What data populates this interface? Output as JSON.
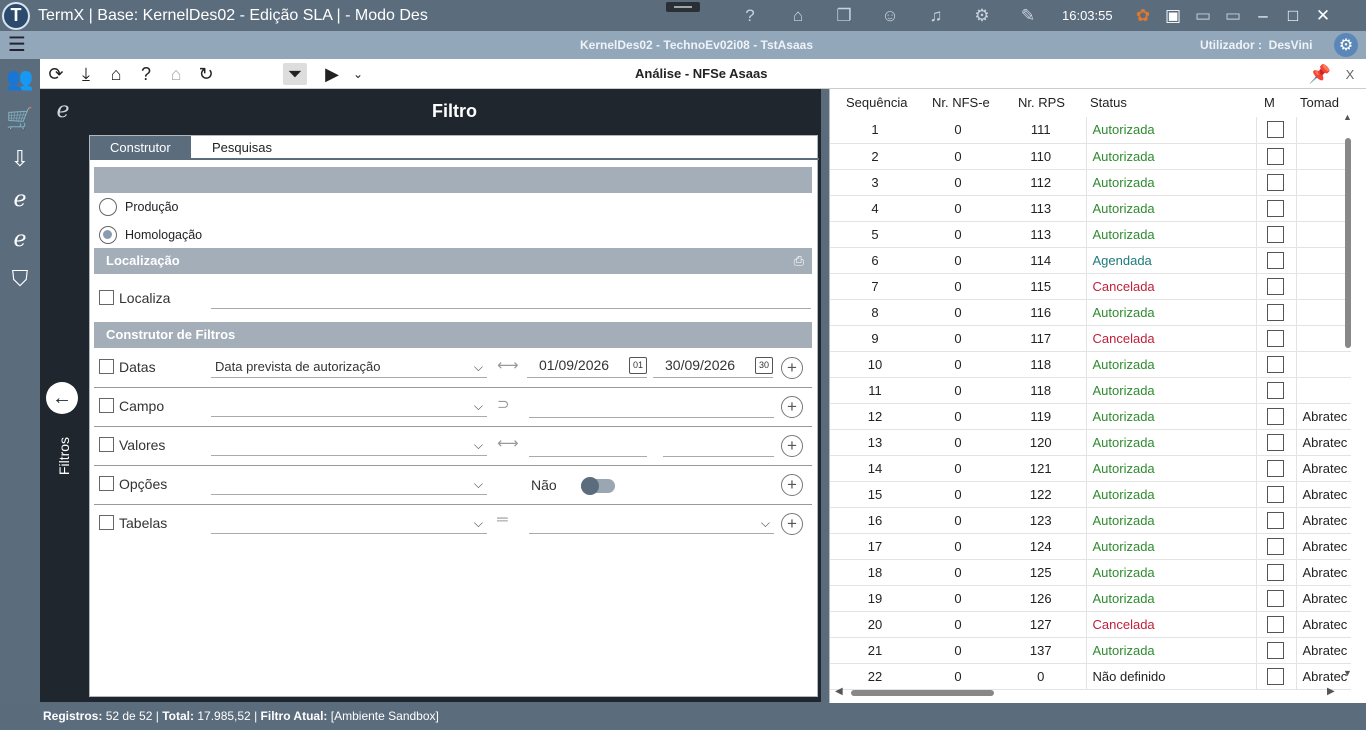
{
  "window": {
    "title": "TermX | Base: KernelDes02 - Edição SLA | - Modo Des",
    "clock": "16:03:55"
  },
  "header": {
    "context": "KernelDes02 - TechnoEv02i08 - TstAsaas",
    "user_label": "Utilizador :",
    "user_name": "DesVini"
  },
  "toolbar": {
    "doc_title": "Análise - NFSe Asaas",
    "close": "X"
  },
  "filter": {
    "title": "Filtro",
    "side_label": "Filtros",
    "tabs": [
      "Construtor",
      "Pesquisas"
    ],
    "env": {
      "option1": "Produção",
      "option2": "Homologação",
      "selected": "Homologação"
    },
    "sec_local": "Localização",
    "localiza_label": "Localiza",
    "sec_builder": "Construtor de Filtros",
    "rows": {
      "datas": {
        "label": "Datas",
        "field": "Data prevista de autorização",
        "from": "01/09/2026",
        "to": "30/09/2026",
        "cal_from": "01",
        "cal_to": "30"
      },
      "campo": {
        "label": "Campo"
      },
      "valores": {
        "label": "Valores"
      },
      "opcoes": {
        "label": "Opções",
        "toggle_text": "Não"
      },
      "tabelas": {
        "label": "Tabelas"
      }
    }
  },
  "grid": {
    "columns": [
      "Sequência",
      "Nr. NFS-e",
      "Nr. RPS",
      "Status",
      "M",
      "Tomad"
    ],
    "status_colors": {
      "Autorizada": "#2e8b2e",
      "Agendada": "#1f7a7a",
      "Cancelada": "#c0203a",
      "Não definido": "#222222"
    },
    "rows": [
      {
        "seq": "1",
        "nf": "0",
        "rps": "111",
        "status": "Autorizada",
        "tom": ""
      },
      {
        "seq": "2",
        "nf": "0",
        "rps": "110",
        "status": "Autorizada",
        "tom": ""
      },
      {
        "seq": "3",
        "nf": "0",
        "rps": "112",
        "status": "Autorizada",
        "tom": ""
      },
      {
        "seq": "4",
        "nf": "0",
        "rps": "113",
        "status": "Autorizada",
        "tom": ""
      },
      {
        "seq": "5",
        "nf": "0",
        "rps": "113",
        "status": "Autorizada",
        "tom": ""
      },
      {
        "seq": "6",
        "nf": "0",
        "rps": "114",
        "status": "Agendada",
        "tom": ""
      },
      {
        "seq": "7",
        "nf": "0",
        "rps": "115",
        "status": "Cancelada",
        "tom": ""
      },
      {
        "seq": "8",
        "nf": "0",
        "rps": "116",
        "status": "Autorizada",
        "tom": ""
      },
      {
        "seq": "9",
        "nf": "0",
        "rps": "117",
        "status": "Cancelada",
        "tom": ""
      },
      {
        "seq": "10",
        "nf": "0",
        "rps": "118",
        "status": "Autorizada",
        "tom": ""
      },
      {
        "seq": "11",
        "nf": "0",
        "rps": "118",
        "status": "Autorizada",
        "tom": ""
      },
      {
        "seq": "12",
        "nf": "0",
        "rps": "119",
        "status": "Autorizada",
        "tom": "Abratec"
      },
      {
        "seq": "13",
        "nf": "0",
        "rps": "120",
        "status": "Autorizada",
        "tom": "Abratec"
      },
      {
        "seq": "14",
        "nf": "0",
        "rps": "121",
        "status": "Autorizada",
        "tom": "Abratec"
      },
      {
        "seq": "15",
        "nf": "0",
        "rps": "122",
        "status": "Autorizada",
        "tom": "Abratec"
      },
      {
        "seq": "16",
        "nf": "0",
        "rps": "123",
        "status": "Autorizada",
        "tom": "Abratec"
      },
      {
        "seq": "17",
        "nf": "0",
        "rps": "124",
        "status": "Autorizada",
        "tom": "Abratec"
      },
      {
        "seq": "18",
        "nf": "0",
        "rps": "125",
        "status": "Autorizada",
        "tom": "Abratec"
      },
      {
        "seq": "19",
        "nf": "0",
        "rps": "126",
        "status": "Autorizada",
        "tom": "Abratec"
      },
      {
        "seq": "20",
        "nf": "0",
        "rps": "127",
        "status": "Cancelada",
        "tom": "Abratec"
      },
      {
        "seq": "21",
        "nf": "0",
        "rps": "137",
        "status": "Autorizada",
        "tom": "Abratec"
      },
      {
        "seq": "22",
        "nf": "0",
        "rps": "0",
        "status": "Não definido",
        "tom": "Abratec"
      }
    ]
  },
  "status": {
    "records_label": "Registros:",
    "records": "52 de 52",
    "total_label": "Total:",
    "total": "17.985,52",
    "filter_label": "Filtro Atual:",
    "filter": "[Ambiente Sandbox]",
    "sep": "|"
  }
}
